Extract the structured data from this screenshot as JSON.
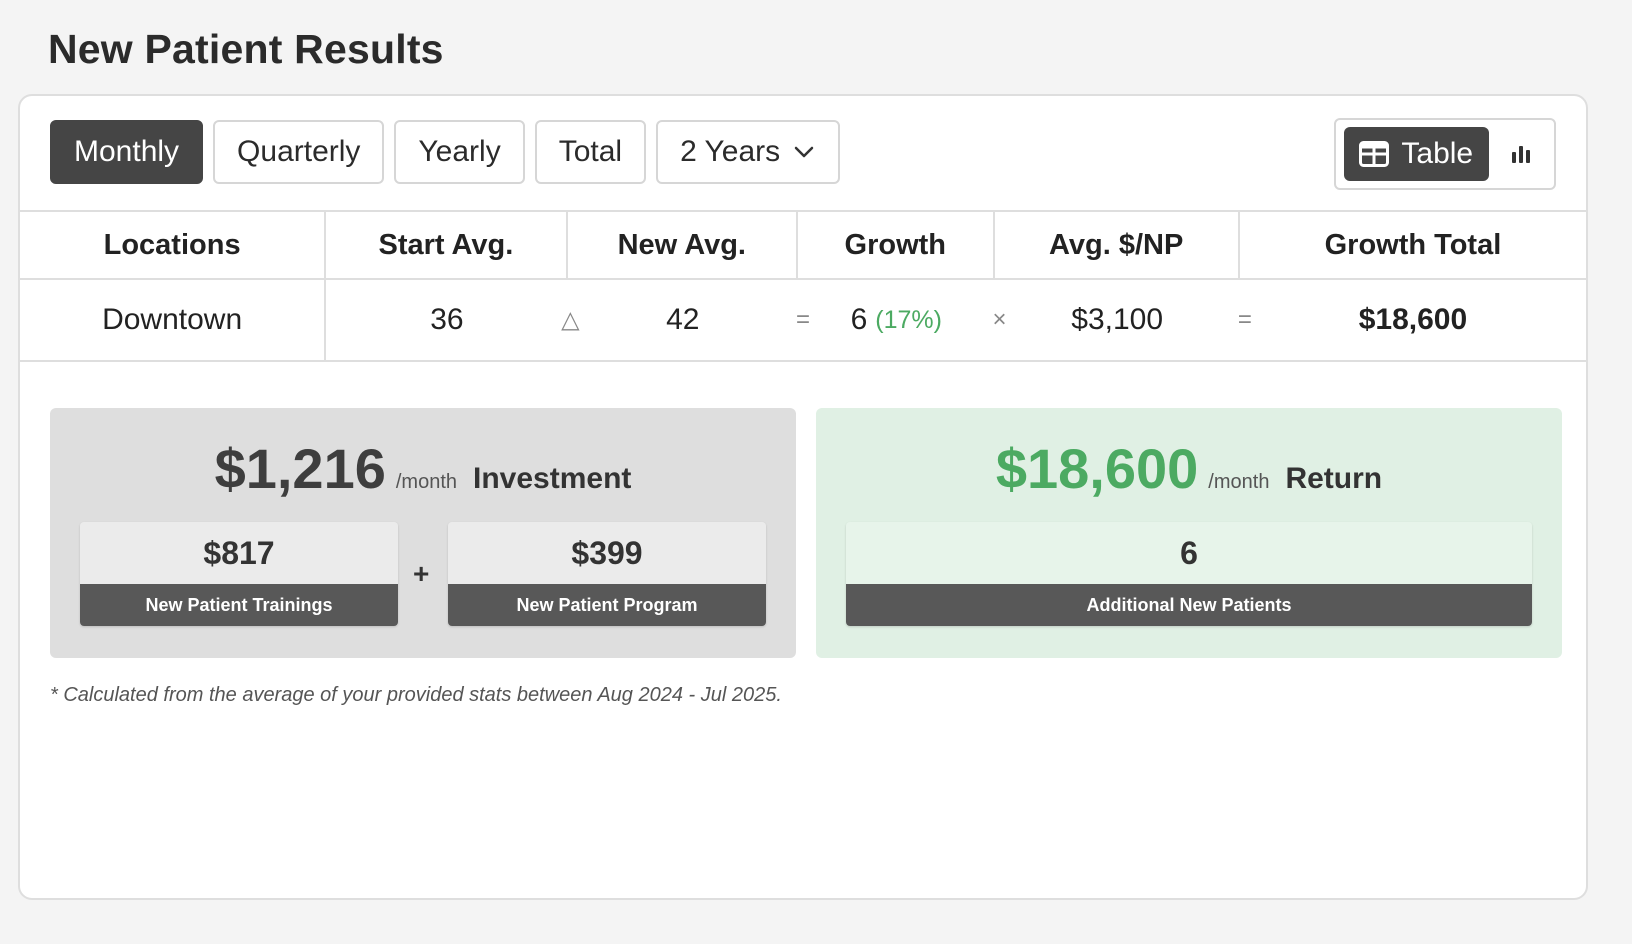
{
  "page": {
    "title": "New Patient Results"
  },
  "toolbar": {
    "periods": [
      "Monthly",
      "Quarterly",
      "Yearly",
      "Total"
    ],
    "active_period": "Monthly",
    "range_select": {
      "selected": "2 Years"
    }
  },
  "view_toggle": {
    "table_label": "Table",
    "active": "table",
    "icons": [
      "table-icon",
      "bar-chart-icon"
    ]
  },
  "table": {
    "headers": [
      "Locations",
      "Start Avg.",
      "New Avg.",
      "Growth",
      "Avg. $/NP",
      "Growth Total"
    ],
    "row": {
      "location": "Downtown",
      "start_avg": "36",
      "op_delta": "△",
      "new_avg": "42",
      "op_eq1": "=",
      "growth": "6",
      "growth_pct": "(17%)",
      "op_times": "×",
      "avg_np": "$3,100",
      "op_eq2": "=",
      "growth_total": "$18,600"
    }
  },
  "investment": {
    "amount": "$1,216",
    "per": "/month",
    "label": "Investment",
    "trainings_value": "$817",
    "trainings_label": "New Patient Trainings",
    "plus": "+",
    "program_value": "$399",
    "program_label": "New Patient Program"
  },
  "return": {
    "amount": "$18,600",
    "per": "/month",
    "label": "Return",
    "patients_value": "6",
    "patients_label": "Additional New Patients"
  },
  "footnote": "* Calculated from the average of your provided stats between Aug 2024 - Jul 2025.",
  "colors": {
    "accent_green": "#4caa62",
    "dark": "#454545"
  }
}
